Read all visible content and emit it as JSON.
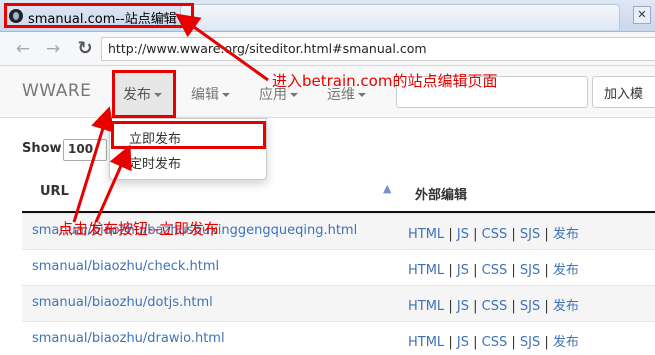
{
  "browser": {
    "tab_title": "smanual.com--站点编辑",
    "tab_close": "×",
    "window_close": "✕",
    "url": "http://www.wware.org/siteditor.html#smanual.com",
    "back_icon": "arrow-left-icon",
    "forward_icon": "arrow-right-icon",
    "reload_icon": "reload-icon"
  },
  "navbar": {
    "brand": "WWARE",
    "menus": [
      {
        "label": "发布"
      },
      {
        "label": "编辑"
      },
      {
        "label": "应用"
      },
      {
        "label": "运维"
      }
    ],
    "search_value": "",
    "add_button": "加入模"
  },
  "dropdown": {
    "items": [
      {
        "label": "立即发布"
      },
      {
        "label": "定时发布"
      }
    ]
  },
  "table": {
    "show_label": "Show",
    "show_value": "100",
    "columns": [
      "URL",
      "外部编辑"
    ],
    "sort_icon": "▲",
    "rows": [
      {
        "url": "smanual/biaozhu/bazhushuxinggengqueqing.html"
      },
      {
        "url": "smanual/biaozhu/check.html"
      },
      {
        "url": "smanual/biaozhu/dotjs.html"
      },
      {
        "url": "smanual/biaozhu/drawio.html"
      }
    ],
    "actions": [
      "HTML",
      "JS",
      "CSS",
      "SJS",
      "发布"
    ],
    "separator": "|"
  },
  "annotations": {
    "top_note": "进入betrain.com的站点编辑页面",
    "bottom_note": "点击发布按钮--立即发布",
    "color": "#e60000"
  }
}
